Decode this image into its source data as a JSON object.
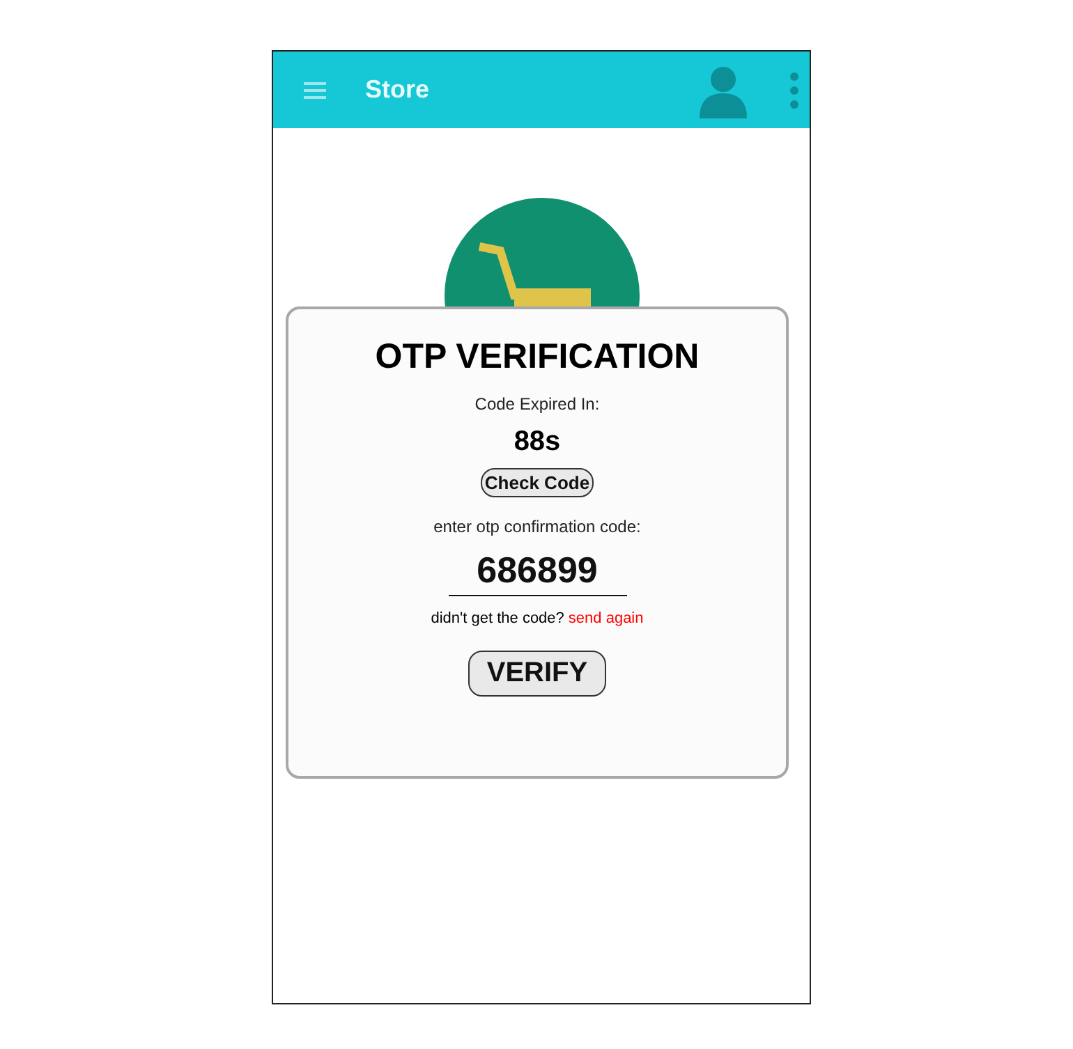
{
  "app_bar": {
    "title": "Store"
  },
  "dialog": {
    "title": "OTP VERIFICATION",
    "timer_label": "Code Expired In:",
    "timer_value": "88s",
    "check_button": "Check Code",
    "code_label": "enter otp confirmation code:",
    "code_value": "686899",
    "resend_prompt": "didn't get the code?",
    "resend_link": "send again",
    "verify_button": "VERIFY"
  }
}
